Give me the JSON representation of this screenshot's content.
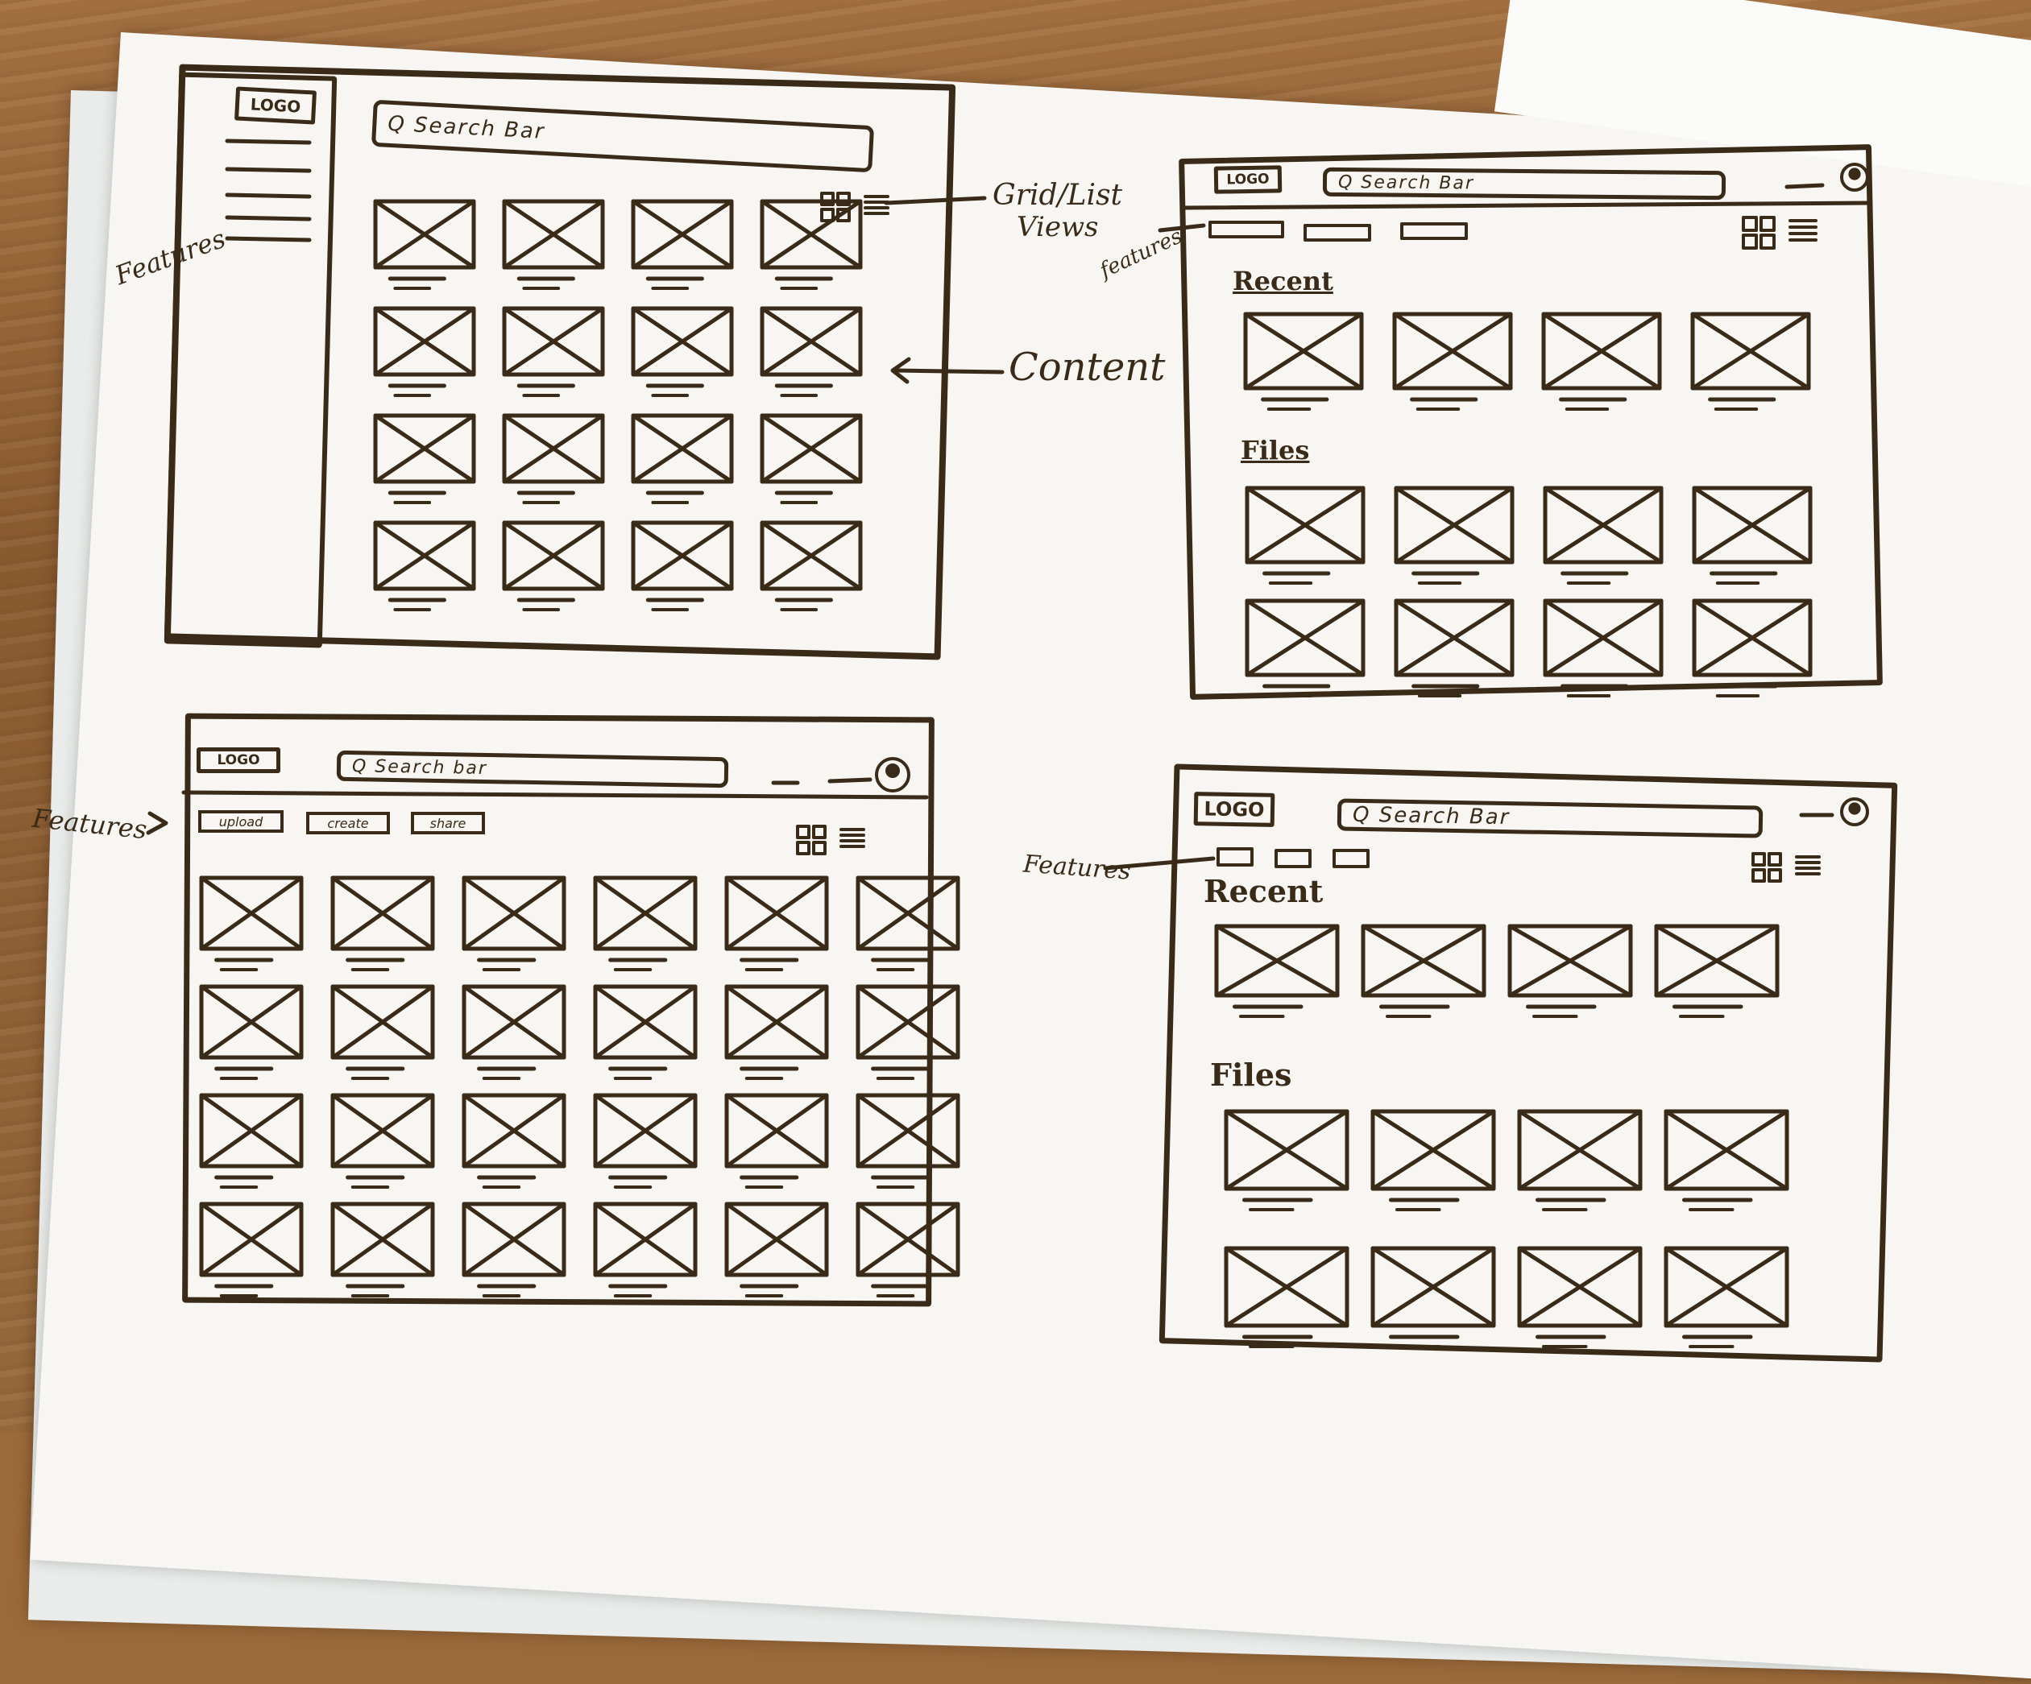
{
  "wireframe_1": {
    "logo": "LOGO",
    "search": "Q  Search Bar"
  },
  "wireframe_2": {
    "logo": "LOGO",
    "search": "Q Search Bar",
    "section_recent": "Recent",
    "section_files": "Files"
  },
  "wireframe_3": {
    "logo": "LOGO",
    "search": "Q  Search  bar",
    "features": [
      "upload",
      "create",
      "share"
    ]
  },
  "wireframe_4": {
    "logo": "LOGO",
    "search": "Q Search Bar",
    "section_recent": "Recent",
    "section_files": "Files"
  },
  "annotations": {
    "features_1": "Features",
    "grid_list": "Grid/List",
    "views": "Views",
    "content": "Content",
    "features_2": "features",
    "features_3": "Features",
    "features_4": "Features"
  },
  "colors": {
    "ink": "#3a2a18",
    "paper": "#f7f6f2",
    "wood": "#9c6a3a"
  }
}
